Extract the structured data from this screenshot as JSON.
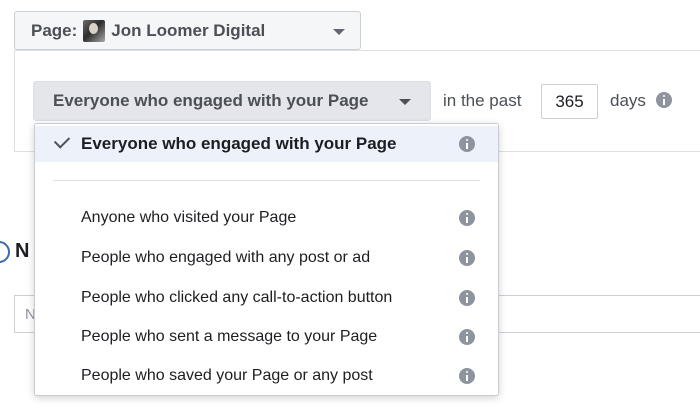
{
  "page_selector": {
    "label": "Page:",
    "page_name": "Jon Loomer Digital"
  },
  "audience_rule": {
    "selected": "Everyone who engaged with your Page",
    "in_the_past": "in the past",
    "days_value": "365",
    "days_label": "days"
  },
  "background": {
    "name_heading_partial": "N",
    "name_input_partial": "N"
  },
  "menu": {
    "items": [
      {
        "label": "Everyone who engaged with your Page",
        "selected": true
      },
      {
        "label": "Anyone who visited your Page",
        "selected": false
      },
      {
        "label": "People who engaged with any post or ad",
        "selected": false
      },
      {
        "label": "People who clicked any call-to-action button",
        "selected": false
      },
      {
        "label": "People who sent a message to your Page",
        "selected": false
      },
      {
        "label": "People who saved your Page or any post",
        "selected": false
      }
    ]
  },
  "colors": {
    "dropdown_bg": "#e4e6eb",
    "selected_item_bg": "#edf2fa",
    "info_icon": "#8d949e",
    "radio_accent": "#4267b2"
  },
  "icons": [
    "page-avatar",
    "chevron-down-icon",
    "info-icon",
    "check-icon"
  ]
}
